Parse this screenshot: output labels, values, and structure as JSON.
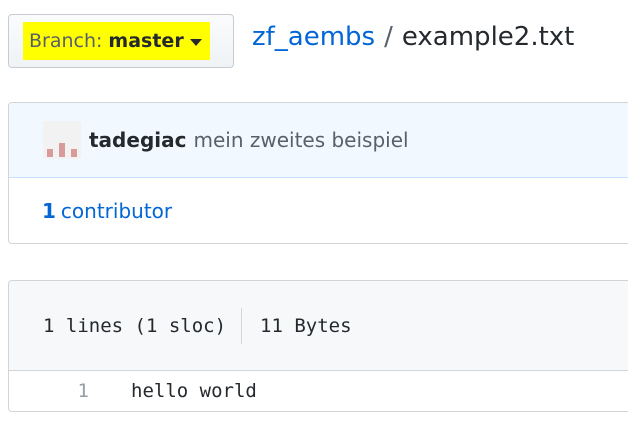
{
  "branch": {
    "label": "Branch:",
    "name": "master",
    "highlight_color": "#ffff00"
  },
  "breadcrumb": {
    "repo": "zf_aembs",
    "separator": "/",
    "file": "example2.txt"
  },
  "commit": {
    "author": "tadegiac",
    "message": "mein zweites beispiel"
  },
  "contributors": {
    "count": "1",
    "label": "contributor"
  },
  "file_info": {
    "lines": "1 lines (1 sloc)",
    "size": "11 Bytes"
  },
  "code": {
    "lines": [
      {
        "number": "1",
        "text": "hello world"
      }
    ]
  },
  "colors": {
    "link": "#0366d6",
    "commit_bg": "#f1f8ff",
    "file_header_bg": "#f6f8fa"
  }
}
